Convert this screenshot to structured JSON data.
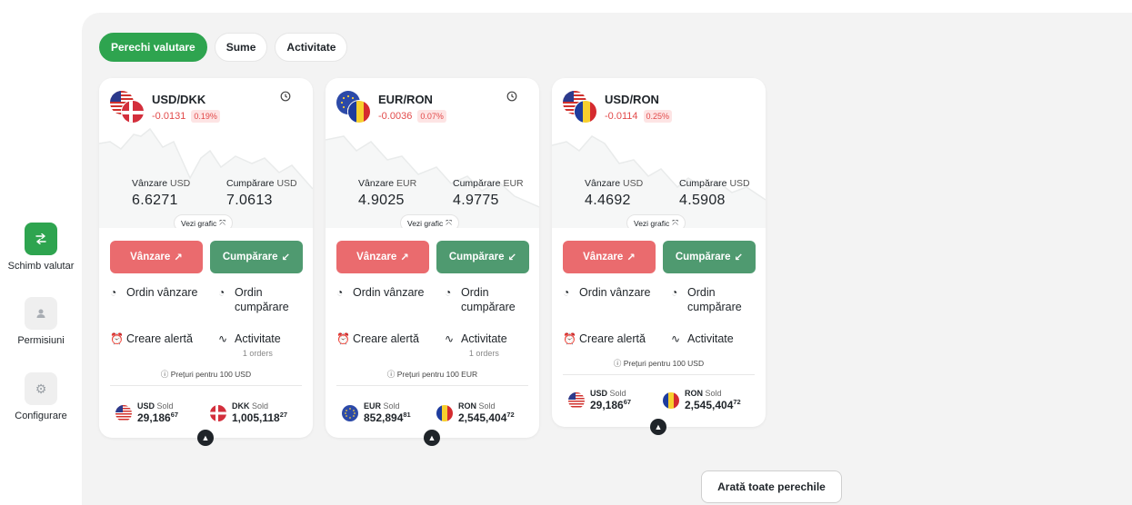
{
  "sidebar": {
    "items": [
      {
        "label": "Schimb valutar",
        "icon": "exchange-icon"
      },
      {
        "label": "Permisiuni",
        "icon": "user-icon"
      },
      {
        "label": "Configurare",
        "icon": "gear-icon"
      }
    ]
  },
  "tabs": [
    {
      "label": "Perechi valutare"
    },
    {
      "label": "Sume"
    },
    {
      "label": "Activitate"
    }
  ],
  "common": {
    "sell_label": "Vânzare",
    "buy_label": "Cumpărare",
    "chart_label": "Vezi grafic",
    "sell_button": "Vânzare",
    "buy_button": "Cumpărare",
    "sell_order": "Ordin vânzare",
    "buy_order_1": "Ordin",
    "buy_order_2": "cumpărare",
    "alert": "Creare alertă",
    "activity": "Activitate",
    "sold_label": "Sold"
  },
  "cards": [
    {
      "pair": "USD/DKK",
      "change": "-0.0131",
      "pct": "0.19%",
      "base": "USD",
      "quote": "DKK",
      "sell_cur": "USD",
      "buy_cur": "USD",
      "sell_main": "6.",
      "sell_big": "6271",
      "buy_main": "7.",
      "buy_big": "0613",
      "orders": "1 orders",
      "price_note": "Prețuri pentru 100 USD",
      "bal1_cur": "USD",
      "bal1_int": "29,186",
      "bal1_dec": "67",
      "bal2_cur": "DKK",
      "bal2_int": "1,005,118",
      "bal2_dec": "27"
    },
    {
      "pair": "EUR/RON",
      "change": "-0.0036",
      "pct": "0.07%",
      "base": "EUR",
      "quote": "RON",
      "sell_cur": "EUR",
      "buy_cur": "EUR",
      "sell_main": "4.",
      "sell_big": "9025",
      "buy_main": "4.",
      "buy_big": "9775",
      "orders": "1 orders",
      "price_note": "Prețuri pentru 100 EUR",
      "bal1_cur": "EUR",
      "bal1_int": "852,894",
      "bal1_dec": "81",
      "bal2_cur": "RON",
      "bal2_int": "2,545,404",
      "bal2_dec": "72"
    },
    {
      "pair": "USD/RON",
      "change": "-0.0114",
      "pct": "0.25%",
      "base": "USD",
      "quote": "RON",
      "sell_cur": "USD",
      "buy_cur": "USD",
      "sell_main": "4.",
      "sell_big": "4692",
      "buy_main": "4.",
      "buy_big": "5908",
      "orders": "",
      "price_note": "Prețuri pentru 100 USD",
      "bal1_cur": "USD",
      "bal1_int": "29,186",
      "bal1_dec": "67",
      "bal2_cur": "RON",
      "bal2_int": "2,545,404",
      "bal2_dec": "72"
    }
  ],
  "show_all": "Arată toate perechile",
  "colors": {
    "accent_green": "#2ea44f",
    "sell_red": "#ea6b6e",
    "buy_green": "#4f9a70",
    "negative": "#e24a4a"
  }
}
